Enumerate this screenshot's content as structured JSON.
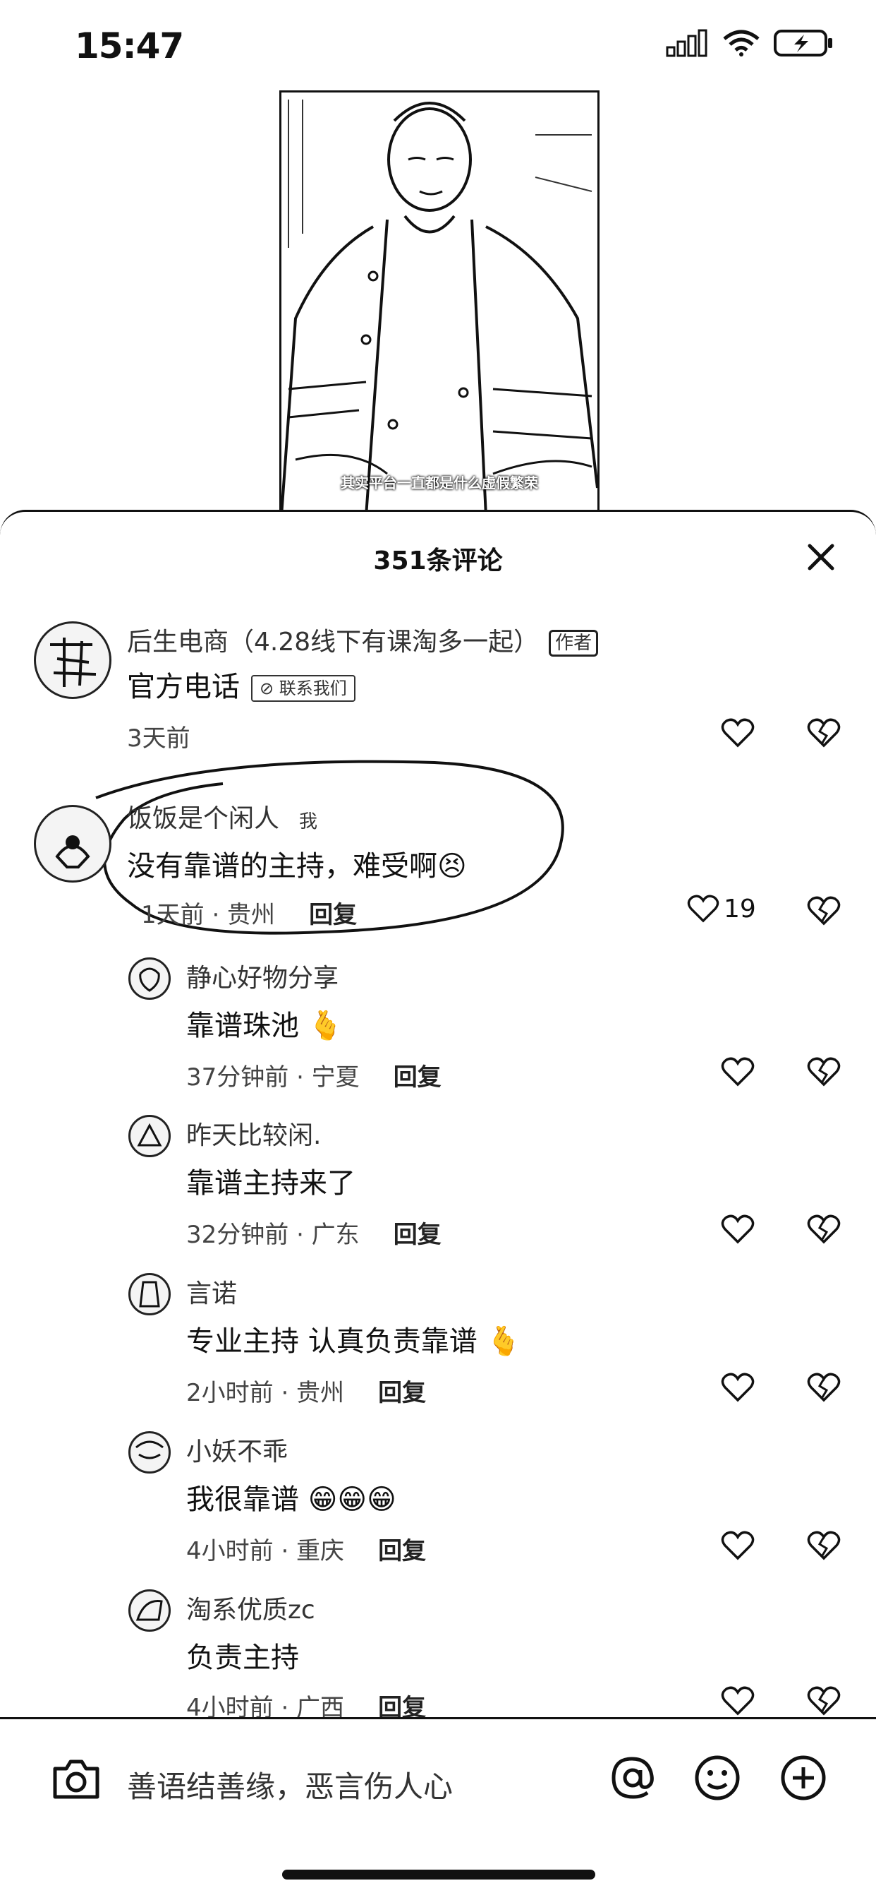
{
  "status_bar": {
    "time": "15:47"
  },
  "video": {
    "caption": "其实平台一直都是什么虚假繁荣"
  },
  "sheet": {
    "title": "351条评论"
  },
  "comments": [
    {
      "user": "后生电商（4.28线下有课淘多一起）",
      "badge": "作者",
      "text": "官方电话",
      "tag": "联系我们",
      "time": "3天前",
      "likes": ""
    },
    {
      "user": "饭饭是个闲人",
      "badge_me": "我",
      "text": "没有靠谱的主持，难受啊😣",
      "time": "1天前 · 贵州",
      "reply": "回复",
      "likes": "19"
    },
    {
      "user": "静心好物分享",
      "text": "靠谱珠池 🫰",
      "time": "37分钟前 · 宁夏",
      "reply": "回复"
    },
    {
      "user": "昨天比较闲.",
      "text": "靠谱主持来了",
      "time": "32分钟前 · 广东",
      "reply": "回复"
    },
    {
      "user": "言诺",
      "text": "专业主持 认真负责靠谱 🫰",
      "time": "2小时前 · 贵州",
      "reply": "回复"
    },
    {
      "user": "小妖不乖",
      "text": "我很靠谱 😁😁😁",
      "time": "4小时前 · 重庆",
      "reply": "回复"
    },
    {
      "user": "淘系优质zc",
      "text": "负责主持",
      "time": "4小时前 · 广西",
      "reply": "回复"
    }
  ],
  "input": {
    "placeholder": "善语结善缘，恶言伤人心"
  }
}
